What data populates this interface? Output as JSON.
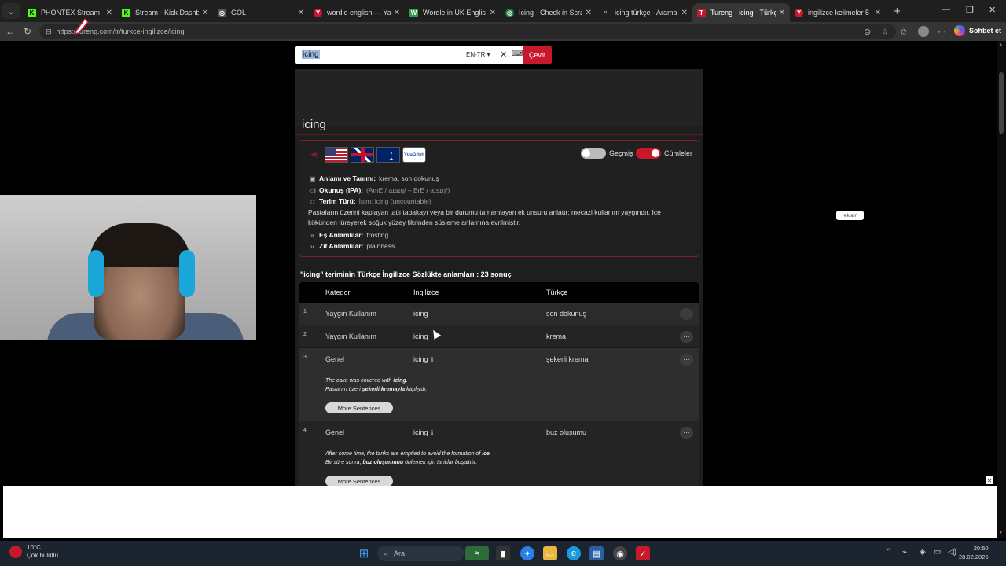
{
  "browser": {
    "tabs": [
      {
        "title": "PHONTEX Stream - Wat",
        "color": "#53fc18",
        "glyph": "K"
      },
      {
        "title": "Stream - Kick Dashboar",
        "color": "#53fc18",
        "glyph": "K"
      },
      {
        "title": "GOL",
        "color": "#888888",
        "glyph": "◎"
      },
      {
        "title": "wordle english — Yande",
        "color": "#c9182c",
        "glyph": "Y"
      },
      {
        "title": "Wordle in UK English - W",
        "color": "#2e9e48",
        "glyph": "W"
      },
      {
        "title": "Icing - Check in Scrabbl",
        "color": "#1e7e3e",
        "glyph": "◎"
      },
      {
        "title": "icing türkçe - Arama",
        "color": "#888888",
        "glyph": "⌕"
      },
      {
        "title": "Tureng - icing - Türkçe",
        "color": "#c9182c",
        "glyph": "T"
      },
      {
        "title": "ingilizce kelimeler 5 har",
        "color": "#c9182c",
        "glyph": "Y"
      }
    ],
    "url": "https://tureng.com/tr/turkce-ingilizce/icing",
    "chat_label": "Sohbet et"
  },
  "search": {
    "value": "icing",
    "lang": "EN-TR",
    "button": "Çevir"
  },
  "entry": {
    "word": "icing",
    "toggle_history": "Geçmiş",
    "toggle_sentences": "Cümleler",
    "flag_yg": "YouGlish",
    "meaning_label": "Anlamı ve Tanımı:",
    "meaning_value": "krema, son dokunuş",
    "ipa_label": "Okunuş (IPA):",
    "ipa_value": "(AmE / aɪsɪŋ/ – BrE / aɪsɪŋ/)",
    "type_label": "Terim Türü:",
    "type_value": "İsim: icing (uncountable)",
    "description": "Pastaların üzerini kaplayan tatlı tabakayı veya bir durumu tamamlayan ek unsuru anlatır; mecazi kullanım yaygındır. Ice kökünden türeyerek soğuk yüzey fikrinden süsleme anlamına evrilmiştir.",
    "synonyms_label": "Eş Anlamlılar:",
    "synonyms_value": "frosting",
    "antonyms_label": "Zıt Anlamlılar:",
    "antonyms_value": "plainness"
  },
  "results": {
    "heading": "\"icing\" teriminin Türkçe İngilizce Sözlükte anlamları : 23 sonuç",
    "columns": {
      "category": "Kategori",
      "english": "İngilizce",
      "turkish": "Türkçe"
    },
    "rows": [
      {
        "num": "1",
        "category": "Yaygın Kullanım",
        "english": "icing",
        "turkish": "son dokunuş"
      },
      {
        "num": "2",
        "category": "Yaygın Kullanım",
        "english": "icing",
        "turkish": "krema"
      },
      {
        "num": "3",
        "category": "Genel",
        "english": "icing",
        "turkish": "şekerli krema",
        "ex_en_pre": "The cake was covered with ",
        "ex_en_bold": "icing",
        "ex_en_post": ".",
        "ex_tr_pre": "Pastanın üzeri ",
        "ex_tr_bold": "şekerli kremayla",
        "ex_tr_post": " kaplıydı.",
        "more": "More Sentences"
      },
      {
        "num": "4",
        "category": "Genel",
        "english": "icing",
        "turkish": "buz oluşumu",
        "ex_en_pre": "After some time, the tanks are emptied to avoid the formation of ",
        "ex_en_bold": "ice",
        "ex_en_post": ".",
        "ex_tr_pre": "Bir süre sonra, ",
        "ex_tr_bold": "buz oluşumunu",
        "ex_tr_post": " önlemek için tanklar boşaltılır.",
        "more": "More Sentences"
      }
    ]
  },
  "ad_label": "reklam",
  "taskbar": {
    "temp": "10°C",
    "weather": "Çok bulutlu",
    "search": "Ara",
    "time": "20:50",
    "date": "28.02.2026"
  }
}
